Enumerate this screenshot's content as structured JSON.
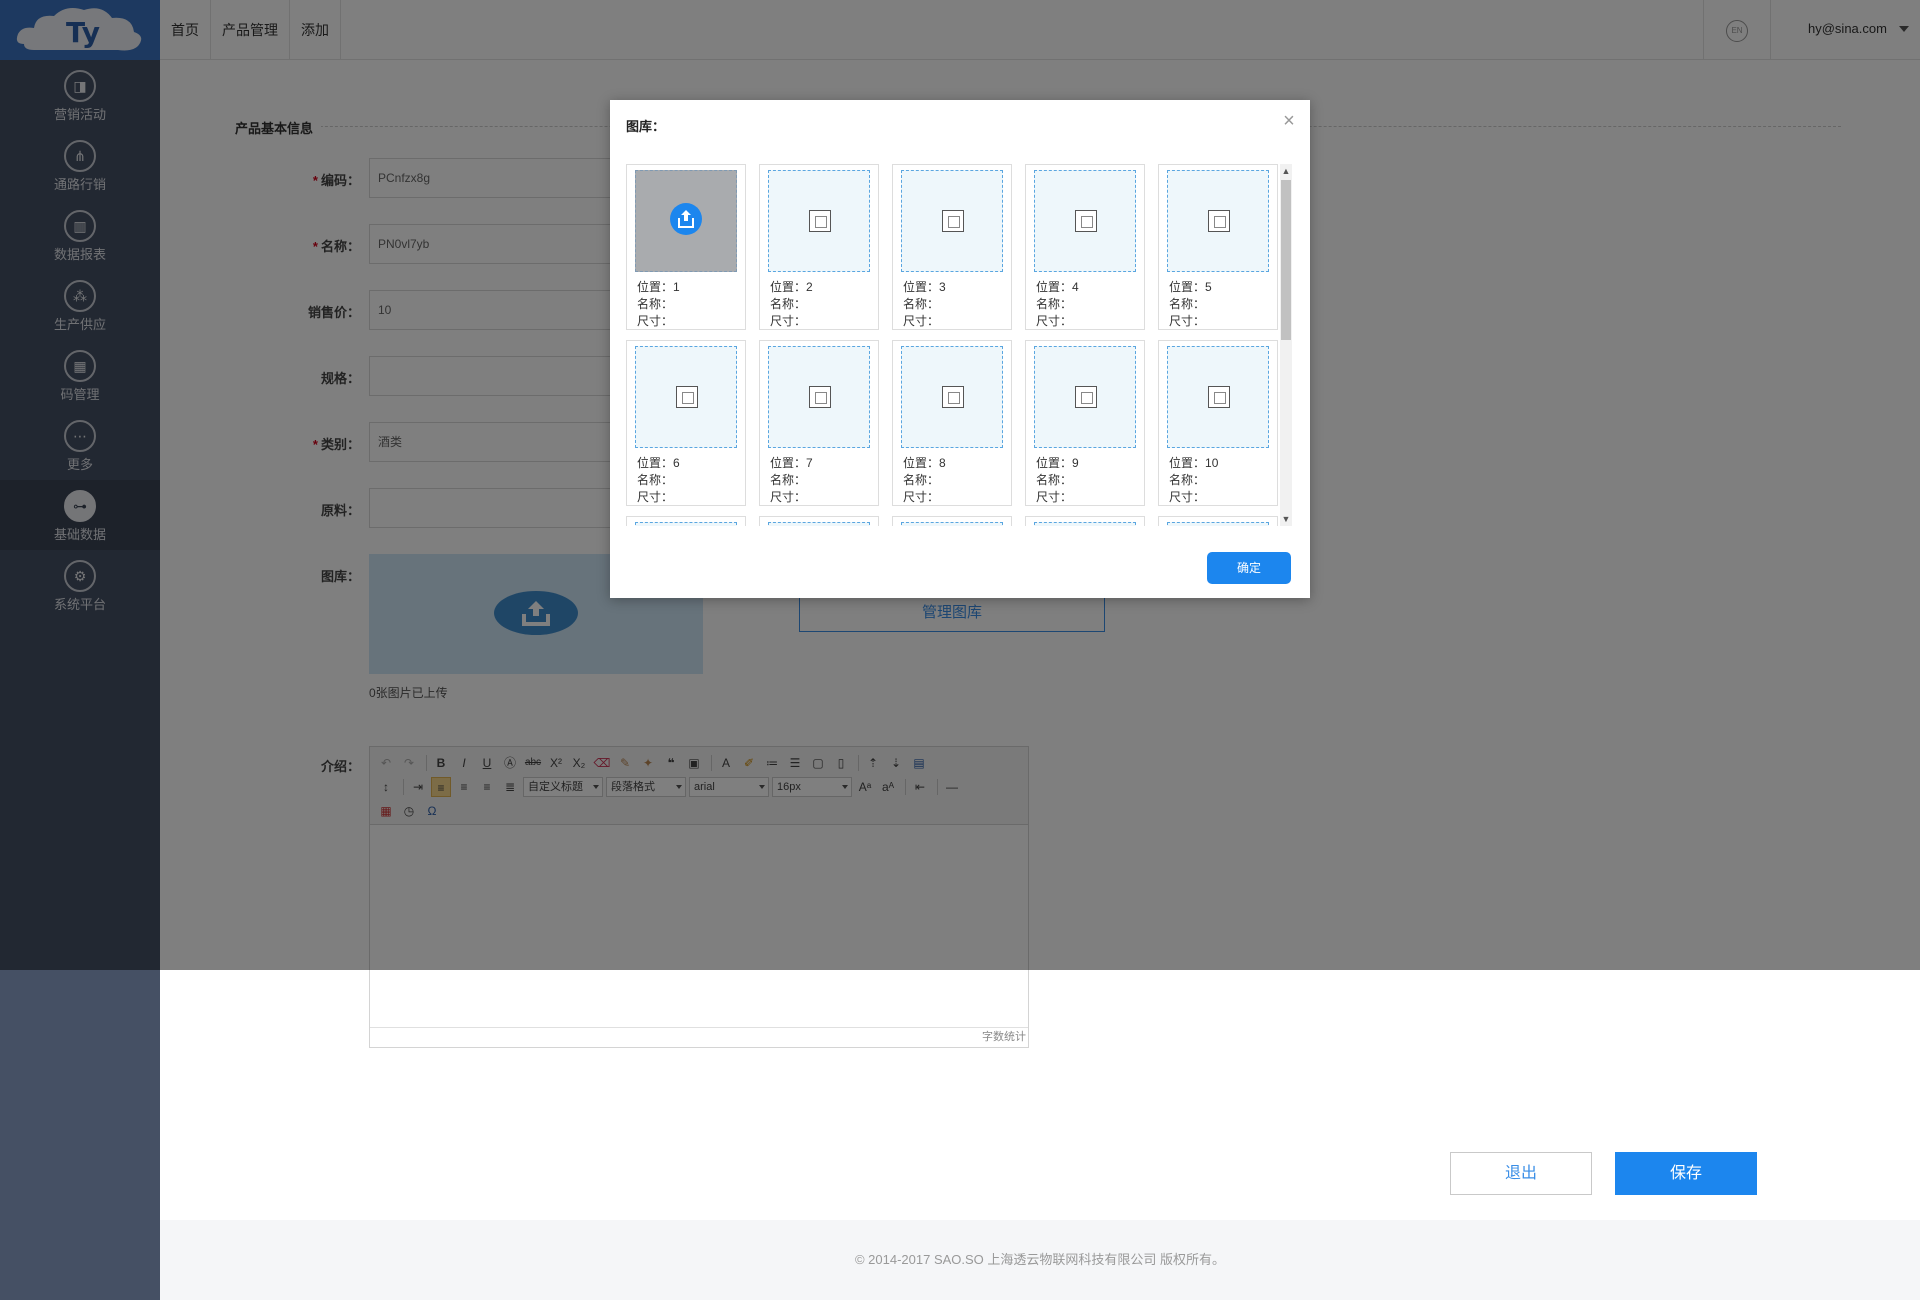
{
  "header": {
    "nav": [
      "首页",
      "产品管理",
      "添加"
    ],
    "lang_badge": "EN",
    "user": "hy@sina.com"
  },
  "sidebar": {
    "items": [
      {
        "label": "营销活动",
        "icon": "bag-icon",
        "glyph": "◨"
      },
      {
        "label": "通路行销",
        "icon": "network-icon",
        "glyph": "⋔"
      },
      {
        "label": "数据报表",
        "icon": "bar-chart-icon",
        "glyph": "▥"
      },
      {
        "label": "生产供应",
        "icon": "cluster-icon",
        "glyph": "⁂"
      },
      {
        "label": "码管理",
        "icon": "qr-code-icon",
        "glyph": "▦"
      },
      {
        "label": "更多",
        "icon": "more-icon",
        "glyph": "⋯"
      },
      {
        "label": "基础数据",
        "icon": "hierarchy-icon",
        "glyph": "⊶",
        "active": true
      },
      {
        "label": "系统平台",
        "icon": "gear-icon",
        "glyph": "⚙"
      }
    ]
  },
  "form": {
    "section_title": "产品基本信息",
    "code_label": "编码：",
    "code_value": "PCnfzx8g",
    "name_label": "名称：",
    "name_value": "PN0vl7yb",
    "price_label": "销售价：",
    "price_value": "10",
    "spec_label": "规格：",
    "spec_value": "",
    "category_label": "类别：",
    "category_value": "酒类",
    "material_label": "原料：",
    "material_value": "",
    "gallery_label": "图库：",
    "manage_gallery": "管理图库",
    "upload_count": "0张图片已上传",
    "intro_label": "介绍："
  },
  "editor": {
    "custom_heading": "自定义标题",
    "paragraph_format": "段落格式",
    "font_family": "arial",
    "font_size": "16px",
    "word_count": "字数统计"
  },
  "actions": {
    "exit": "退出",
    "save": "保存"
  },
  "footer": {
    "copyright": "© 2014-2017 SAO.SO 上海透云物联网科技有限公司 版权所有。"
  },
  "modal": {
    "title": "图库：",
    "position_label": "位置：",
    "name_label": "名称：",
    "size_label": "尺寸：",
    "slots": [
      "1",
      "2",
      "3",
      "4",
      "5",
      "6",
      "7",
      "8",
      "9",
      "10"
    ],
    "ok": "确定"
  },
  "colors": {
    "primary": "#1c86ee",
    "sidebar": "#455064",
    "logo_bg": "#3a73c0"
  }
}
